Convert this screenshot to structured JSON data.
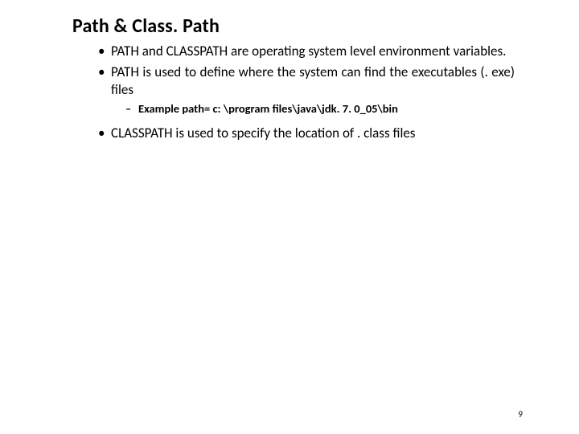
{
  "title": "Path & Class. Path",
  "bullets": {
    "b1": "PATH and CLASSPATH are operating system level environment variables.",
    "b2": "PATH is used to define where the system can find the executables (. exe) files",
    "b2_sub1": "Example path= c: \\program files\\java\\jdk. 7. 0_05\\bin",
    "b3": "CLASSPATH is used to specify the location of . class files"
  },
  "page_number": "9"
}
